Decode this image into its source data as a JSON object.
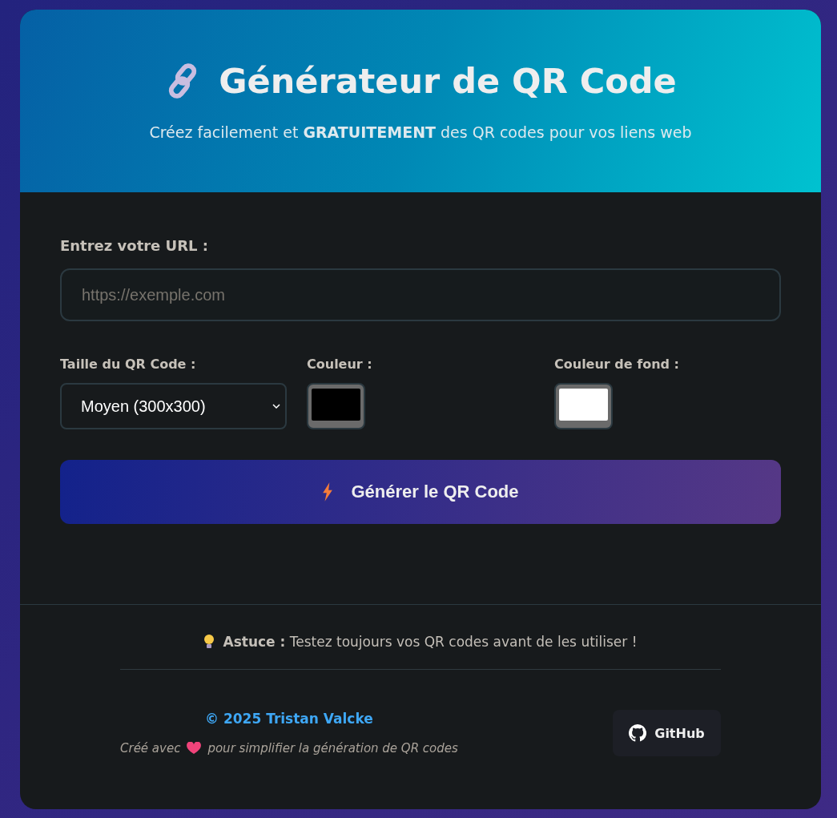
{
  "header": {
    "title": "Générateur de QR Code",
    "subtitle": "Créez facilement et **GRATUITEMENT** des QR codes pour vos liens web"
  },
  "url_field": {
    "label": "Entrez votre URL :",
    "placeholder": "https://exemple.com"
  },
  "options": [
    {
      "kind": "select",
      "label": "Taille du QR Code :",
      "value": "Moyen (300x300)"
    },
    {
      "kind": "color",
      "label": "Couleur :",
      "color": "#000000"
    },
    {
      "kind": "color",
      "label": "Couleur de fond :",
      "color": "#ffffff"
    }
  ],
  "generate_button": {
    "label": "Générer le QR Code"
  },
  "tip": {
    "text": "**Astuce :** Testez toujours vos QR codes avant de les utiliser !"
  },
  "footer": {
    "copyright": "© 2025 Tristan Valcke",
    "made_with_before": "Créé avec",
    "made_with_after": "pour simplifier la génération de QR codes",
    "github": "GitHub"
  }
}
